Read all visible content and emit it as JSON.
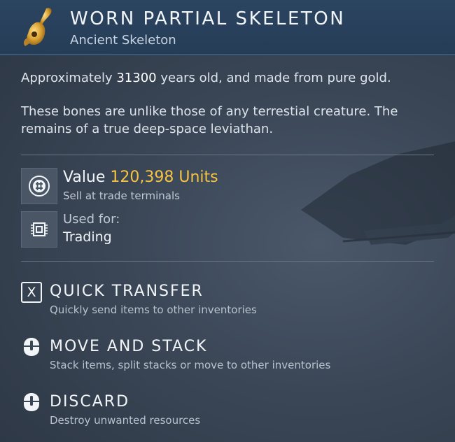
{
  "item": {
    "icon": "golden-skeleton-icon",
    "title": "WORN PARTIAL SKELETON",
    "subtitle": "Ancient Skeleton"
  },
  "description": {
    "age_prefix": "Approximately ",
    "age_value": "31300",
    "age_suffix": " years old, and made from pure gold.",
    "lore": "These bones are unlike those of any terrestial creature. The remains of a true deep-space leviathan."
  },
  "value": {
    "icon": "units-currency-icon",
    "label": "Value",
    "amount": "120,398 Units",
    "note": "Sell at trade terminals"
  },
  "usage": {
    "icon": "trade-chip-icon",
    "label": "Used for:",
    "value": "Trading"
  },
  "actions": [
    {
      "icon": "x-key-icon",
      "key": "X",
      "title": "QUICK TRANSFER",
      "description": "Quickly send items to other inventories"
    },
    {
      "icon": "mouse-click-icon",
      "title": "MOVE AND STACK",
      "description": "Stack items, split stacks or move to other inventories"
    },
    {
      "icon": "mouse-click-icon",
      "title": "DISCARD",
      "description": "Destroy unwanted resources"
    }
  ],
  "colors": {
    "header_bg": "#2b4460",
    "units_accent": "#f5c242",
    "text_primary": "#f2f5f8"
  }
}
